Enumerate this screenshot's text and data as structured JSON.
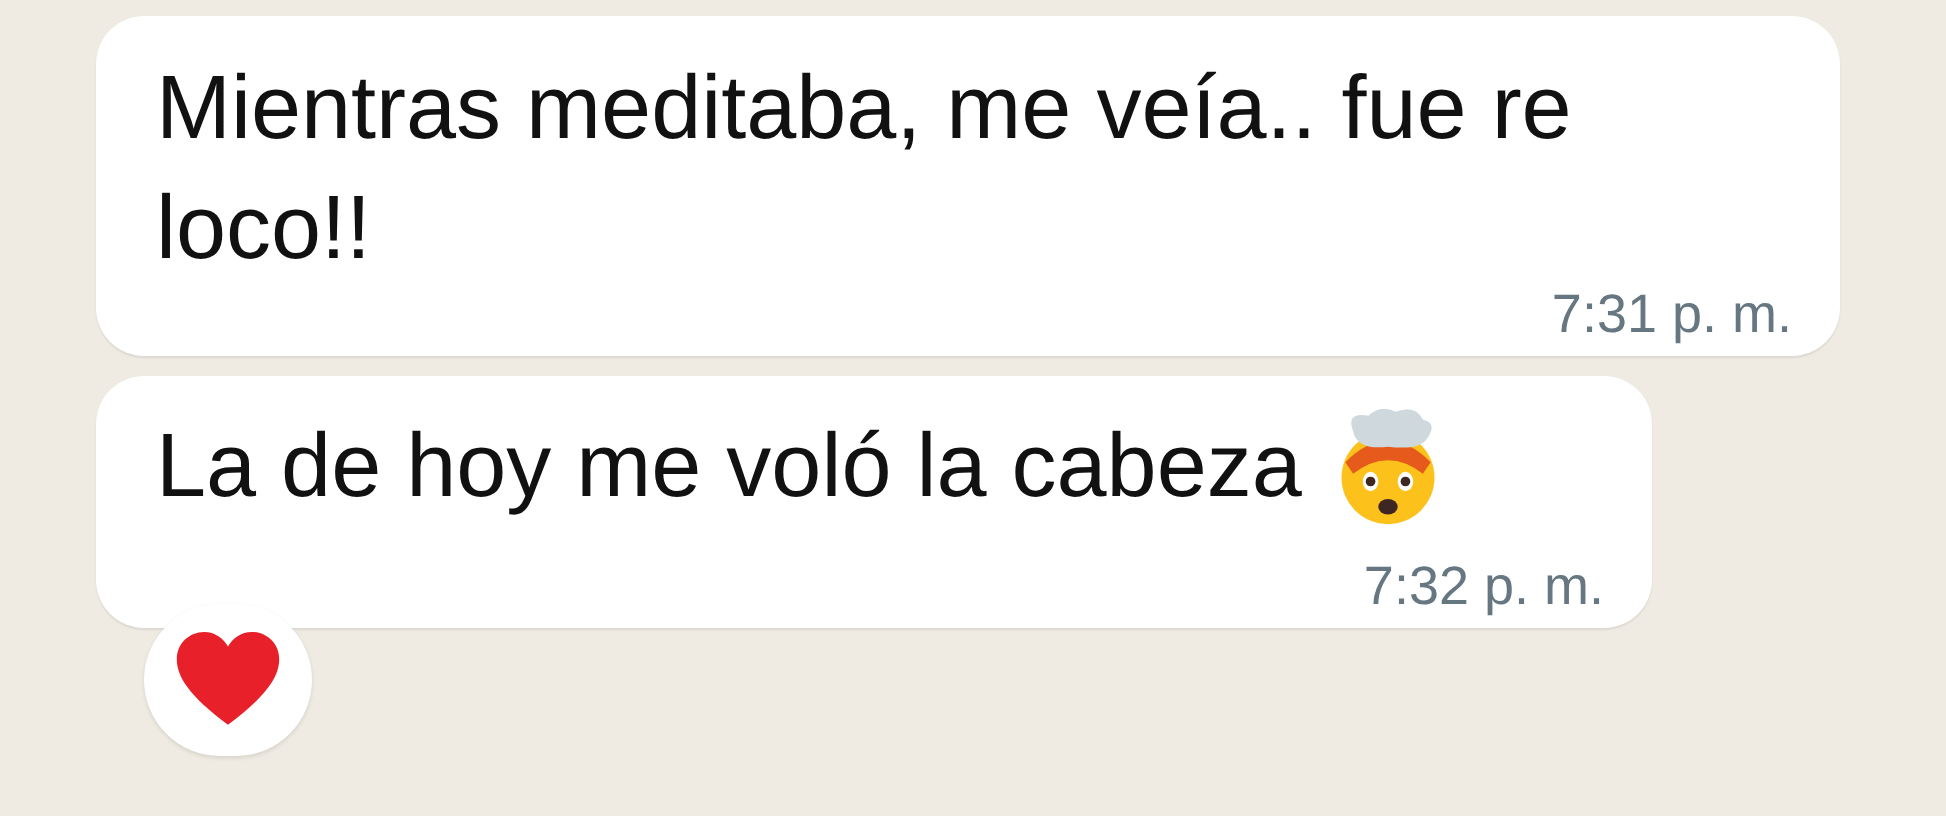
{
  "messages": [
    {
      "text": "Mientras meditaba, me veía.. fue re loco!!",
      "time": "7:31 p. m."
    },
    {
      "text": "La de hoy me voló la cabeza",
      "emoji": {
        "kind": "exploding-head"
      },
      "time": "7:32 p. m.",
      "reaction": {
        "kind": "heart"
      }
    }
  ]
}
